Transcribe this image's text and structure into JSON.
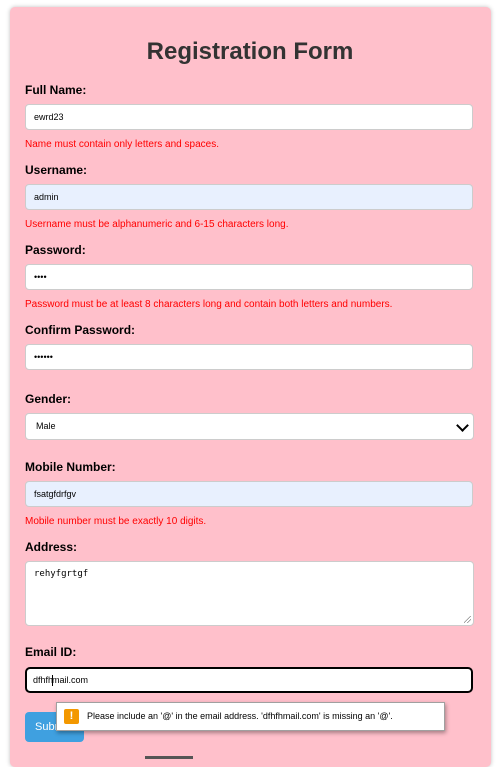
{
  "form": {
    "title": "Registration Form",
    "full_name": {
      "label": "Full Name:",
      "value": "ewrd23",
      "error": "Name must contain only letters and spaces."
    },
    "username": {
      "label": "Username:",
      "value": "admin",
      "error": "Username must be alphanumeric and 6-15 characters long."
    },
    "password": {
      "label": "Password:",
      "value": "••••",
      "error": "Password must be at least 8 characters long and contain both letters and numbers."
    },
    "confirm_password": {
      "label": "Confirm Password:",
      "value": "••••••"
    },
    "gender": {
      "label": "Gender:",
      "selected": "Male"
    },
    "mobile": {
      "label": "Mobile Number:",
      "value": "fsatgfdrfgv",
      "error": "Mobile number must be exactly 10 digits."
    },
    "address": {
      "label": "Address:",
      "value": "rehyfgrtgf"
    },
    "email": {
      "label": "Email ID:",
      "value_before_caret": "dfhfh",
      "value_after_caret": "mail.com"
    },
    "submit_label": "Submit",
    "validation_tooltip": {
      "icon": "warning-icon",
      "message": "Please include an '@' in the email address. 'dfhfhmail.com' is missing an '@'."
    }
  },
  "colors": {
    "card_bg": "#ffc0cb",
    "error": "#ff0000",
    "submit_bg": "#3fa0e0",
    "autofill_bg": "#e8f0fe"
  }
}
